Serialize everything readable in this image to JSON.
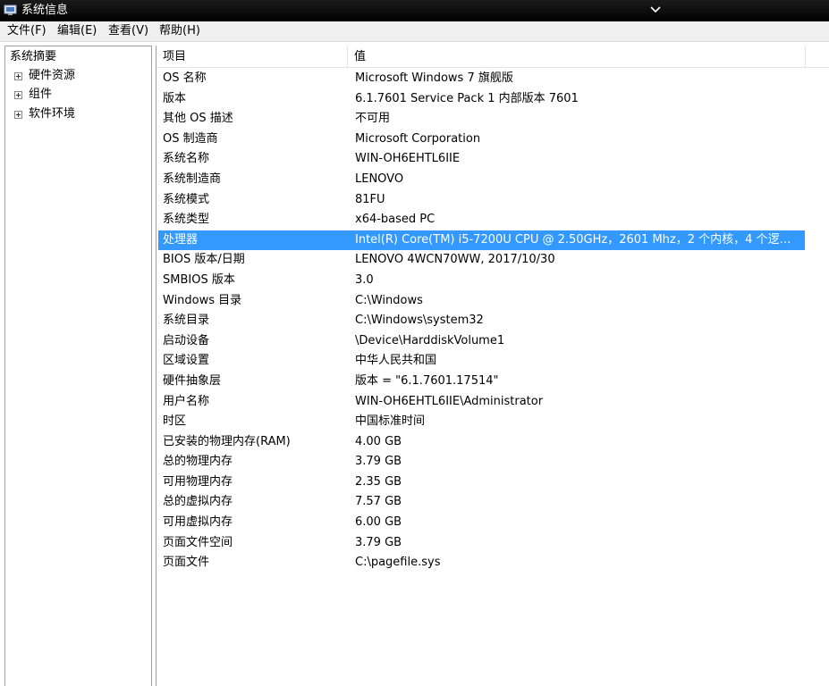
{
  "window": {
    "title": "系统信息"
  },
  "menu": [
    "文件(F)",
    "编辑(E)",
    "查看(V)",
    "帮助(H)"
  ],
  "tree": {
    "root": "系统摘要",
    "items": [
      "硬件资源",
      "组件",
      "软件环境"
    ]
  },
  "columns": {
    "item": "项目",
    "value": "值"
  },
  "rows": [
    {
      "item": "OS 名称",
      "value": "Microsoft Windows 7 旗舰版"
    },
    {
      "item": "版本",
      "value": "6.1.7601 Service Pack 1 内部版本 7601"
    },
    {
      "item": "其他 OS 描述",
      "value": "不可用"
    },
    {
      "item": "OS 制造商",
      "value": "Microsoft Corporation"
    },
    {
      "item": "系统名称",
      "value": "WIN-OH6EHTL6IIE"
    },
    {
      "item": "系统制造商",
      "value": "LENOVO"
    },
    {
      "item": "系统模式",
      "value": "81FU"
    },
    {
      "item": "系统类型",
      "value": "x64-based PC"
    },
    {
      "item": "处理器",
      "value": "Intel(R) Core(TM) i5-7200U CPU @ 2.50GHz，2601 Mhz，2 个内核，4 个逻辑处..."
    },
    {
      "item": "BIOS 版本/日期",
      "value": "LENOVO 4WCN70WW, 2017/10/30"
    },
    {
      "item": "SMBIOS 版本",
      "value": "3.0"
    },
    {
      "item": "Windows 目录",
      "value": "C:\\Windows"
    },
    {
      "item": "系统目录",
      "value": "C:\\Windows\\system32"
    },
    {
      "item": "启动设备",
      "value": "\\Device\\HarddiskVolume1"
    },
    {
      "item": "区域设置",
      "value": "中华人民共和国"
    },
    {
      "item": "硬件抽象层",
      "value": "版本 = \"6.1.7601.17514\""
    },
    {
      "item": "用户名称",
      "value": "WIN-OH6EHTL6IIE\\Administrator"
    },
    {
      "item": "时区",
      "value": "中国标准时间"
    },
    {
      "item": "已安装的物理内存(RAM)",
      "value": "4.00 GB"
    },
    {
      "item": "总的物理内存",
      "value": "3.79 GB"
    },
    {
      "item": "可用物理内存",
      "value": "2.35 GB"
    },
    {
      "item": "总的虚拟内存",
      "value": "7.57 GB"
    },
    {
      "item": "可用虚拟内存",
      "value": "6.00 GB"
    },
    {
      "item": "页面文件空间",
      "value": "3.79 GB"
    },
    {
      "item": "页面文件",
      "value": "C:\\pagefile.sys"
    }
  ],
  "selected_row": 8,
  "colors": {
    "selection": "#3399ff",
    "titlebar": "#000000",
    "menubar": "#f0f0f0"
  }
}
